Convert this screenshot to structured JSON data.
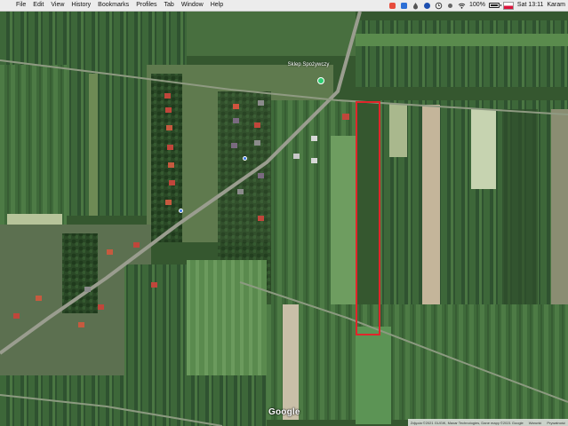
{
  "menubar": {
    "apple_icon": "apple-logo-icon",
    "items": [
      {
        "label": "File"
      },
      {
        "label": "Edit"
      },
      {
        "label": "View"
      },
      {
        "label": "History"
      },
      {
        "label": "Bookmarks"
      },
      {
        "label": "Profiles"
      },
      {
        "label": "Tab"
      },
      {
        "label": "Window"
      },
      {
        "label": "Help"
      }
    ],
    "battery_percent": "100%",
    "battery_level": 1.0,
    "clock": "Sat 13:11",
    "user": "Karam"
  },
  "map": {
    "place_label": "Sklep Spożywczy",
    "logo": "Google",
    "attribution": {
      "imagery": "Zdjęcia ©2021 GUGiK, Maxar Technologies, Dane mapy ©2021 Google",
      "terms": "Warunki",
      "privacy": "Prywatność"
    },
    "highlight_color": "#e0262b"
  }
}
